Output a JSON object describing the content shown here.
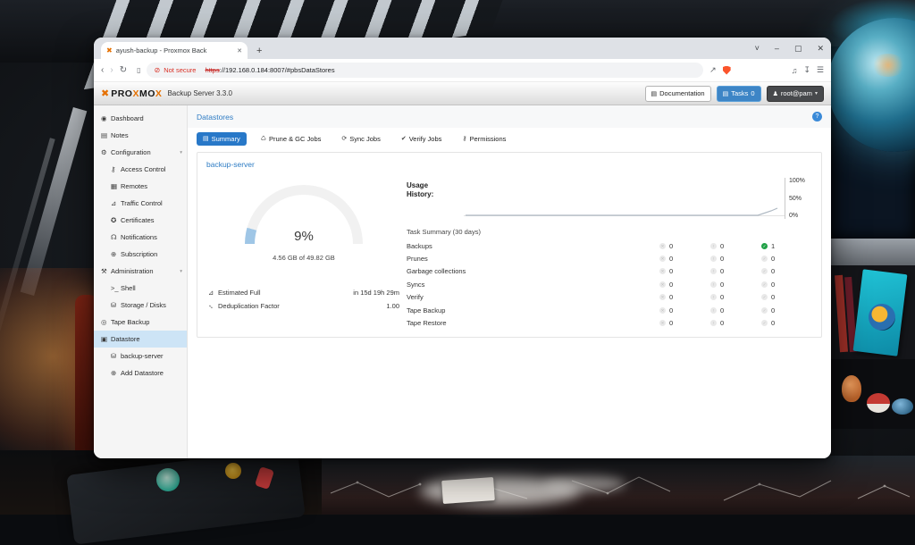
{
  "colors": {
    "accent_blue": "#2878c8",
    "link_blue": "#2e7cc4",
    "proxmox_orange": "#e57000",
    "tasks_button_blue": "#3d85c6",
    "selected_item_bg": "#cde4f6",
    "ok_green": "#21a147",
    "not_secure_red": "#d93025",
    "gauge_fill_blue": "#9fc6e6"
  },
  "browser": {
    "tab_title": "ayush-backup - Proxmox Back",
    "tab_close": "✕",
    "new_tab": "+",
    "controls": {
      "menu": "˅",
      "minimize": "–",
      "maximize": "▢",
      "close": "✕"
    },
    "nav": {
      "back": "‹",
      "forward": "›",
      "reload": "↻",
      "bookmark": "▯"
    },
    "address": {
      "not_secure_icon": "⊘",
      "security_label": "Not secure",
      "url_scheme": "https",
      "url_rest": "://192.168.0.184:8007/#pbsDataStores"
    },
    "right_icons": {
      "share": "↗",
      "media": "♫",
      "download": "↧",
      "menu": "☰"
    }
  },
  "header": {
    "logo_mark": "✖",
    "brand_pro": "PRO",
    "brand_x1": "X",
    "brand_mo": "MO",
    "brand_x2": "X",
    "product": "Backup Server 3.3.0",
    "documentation_label": "Documentation",
    "documentation_icon": "▤",
    "tasks_label": "Tasks",
    "tasks_count": "0",
    "tasks_icon": "▤",
    "user_label": "root@pam",
    "user_icon": "♟",
    "user_caret": "▾"
  },
  "sidebar": {
    "items": [
      {
        "label": "Dashboard",
        "icon": "◉",
        "level": 0
      },
      {
        "label": "Notes",
        "icon": "▤",
        "level": 0
      },
      {
        "label": "Configuration",
        "icon": "⚙",
        "level": 0,
        "chevron": "▾"
      },
      {
        "label": "Access Control",
        "icon": "⚷",
        "level": 1
      },
      {
        "label": "Remotes",
        "icon": "▦",
        "level": 1
      },
      {
        "label": "Traffic Control",
        "icon": "⊿",
        "level": 1
      },
      {
        "label": "Certificates",
        "icon": "✪",
        "level": 1
      },
      {
        "label": "Notifications",
        "icon": "☊",
        "level": 1
      },
      {
        "label": "Subscription",
        "icon": "⊕",
        "level": 1
      },
      {
        "label": "Administration",
        "icon": "⚒",
        "level": 0,
        "chevron": "▾"
      },
      {
        "label": "Shell",
        "icon": ">_",
        "level": 1
      },
      {
        "label": "Storage / Disks",
        "icon": "⛁",
        "level": 1
      },
      {
        "label": "Tape Backup",
        "icon": "◎",
        "level": 0
      },
      {
        "label": "Datastore",
        "icon": "▣",
        "level": 0,
        "selected": true
      },
      {
        "label": "backup-server",
        "icon": "⛁",
        "level": 1
      },
      {
        "label": "Add Datastore",
        "icon": "⊕",
        "level": 1
      }
    ]
  },
  "main": {
    "page_title": "Datastores",
    "help_icon": "?",
    "tabs": [
      {
        "label": "Summary",
        "icon": "▤",
        "active": true
      },
      {
        "label": "Prune & GC Jobs",
        "icon": "♺"
      },
      {
        "label": "Sync Jobs",
        "icon": "⟳"
      },
      {
        "label": "Verify Jobs",
        "icon": "✔"
      },
      {
        "label": "Permissions",
        "icon": "⚷"
      }
    ],
    "panel_title": "backup-server",
    "gauge": {
      "percent": "9%",
      "detail": "4.56 GB of 49.82 GB"
    },
    "usage": {
      "label_line1": "Usage",
      "label_line2": "History:",
      "tick_top": "100%",
      "tick_mid": "50%",
      "tick_bottom": "0%"
    },
    "tasks": {
      "title": "Task Summary (30 days)",
      "rows": [
        {
          "label": "Backups",
          "error": "0",
          "warning": "0",
          "ok": "1"
        },
        {
          "label": "Prunes",
          "error": "0",
          "warning": "0",
          "ok": "0"
        },
        {
          "label": "Garbage collections",
          "error": "0",
          "warning": "0",
          "ok": "0"
        },
        {
          "label": "Syncs",
          "error": "0",
          "warning": "0",
          "ok": "0"
        },
        {
          "label": "Verify",
          "error": "0",
          "warning": "0",
          "ok": "0"
        },
        {
          "label": "Tape Backup",
          "error": "0",
          "warning": "0",
          "ok": "0"
        },
        {
          "label": "Tape Restore",
          "error": "0",
          "warning": "0",
          "ok": "0"
        }
      ]
    },
    "stats": [
      {
        "label": "Estimated Full",
        "value": "in 15d 19h 29m"
      },
      {
        "label": "Deduplication Factor",
        "value": "1.00"
      }
    ]
  },
  "chart_data": [
    {
      "type": "gauge",
      "title": "Datastore usage",
      "value_pct": 9,
      "label": "9%",
      "sublabel": "4.56 GB of 49.82 GB"
    },
    {
      "type": "line",
      "title": "Usage History",
      "ylabel": "%",
      "ylim": [
        0,
        100
      ],
      "yticks": [
        "0%",
        "50%",
        "100%"
      ],
      "x_range": "last 30 days",
      "legend": "off",
      "grid": "off",
      "points_pct": [
        0,
        0,
        0,
        0,
        0,
        0,
        0,
        0,
        0,
        0,
        0,
        0,
        0,
        0,
        0,
        0,
        0,
        0,
        0,
        0,
        0,
        0,
        0,
        0,
        0,
        0,
        0,
        0,
        0,
        9
      ]
    }
  ]
}
